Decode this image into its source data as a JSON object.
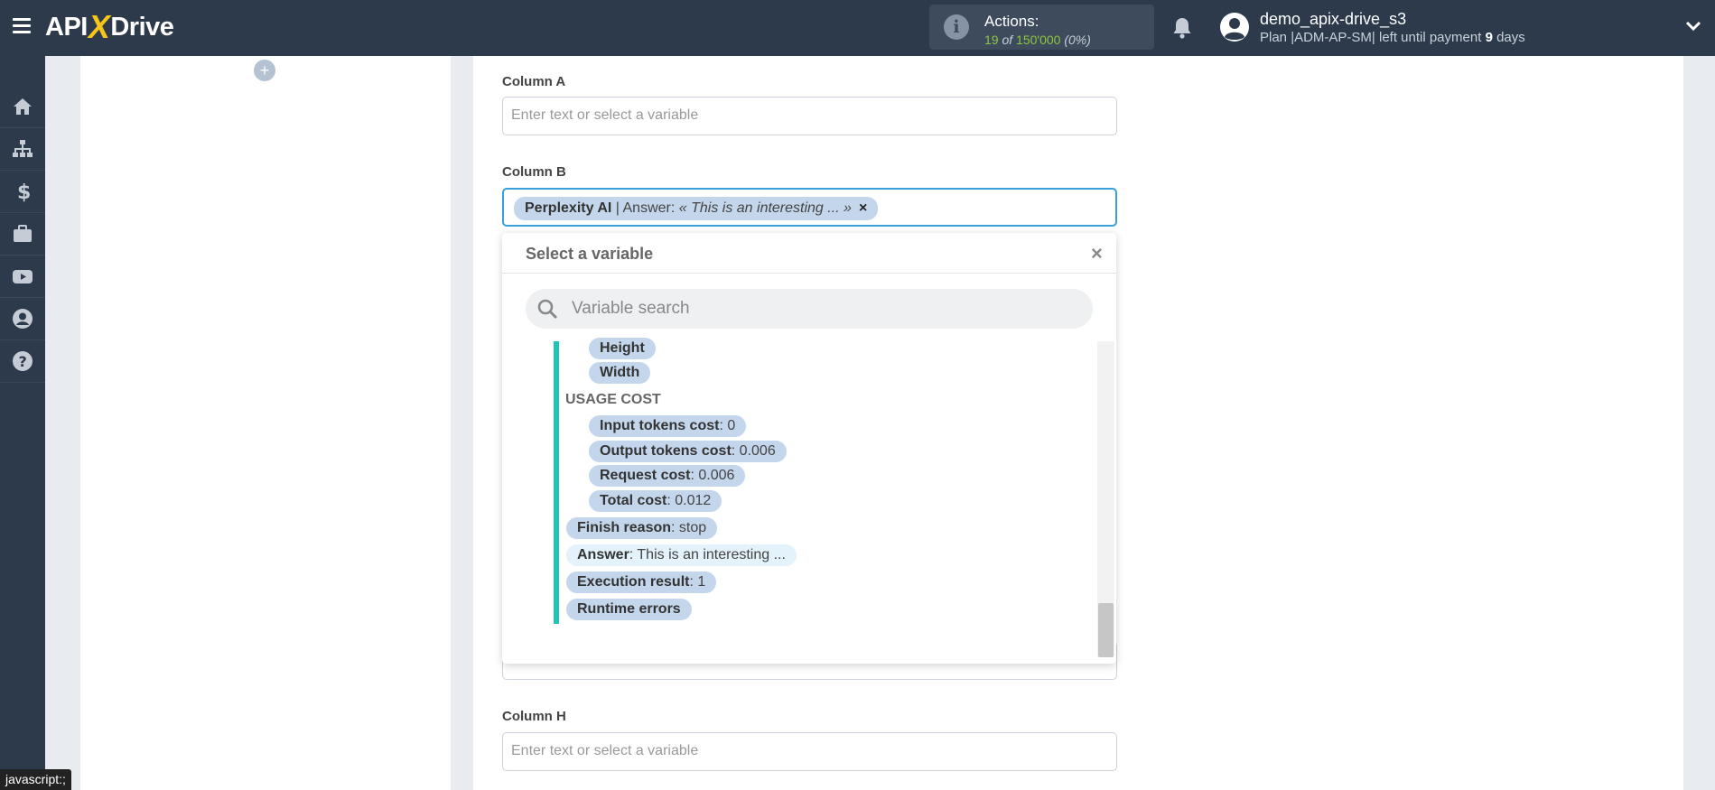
{
  "header": {
    "logo_api": "API",
    "logo_x": "X",
    "logo_drive": "Drive",
    "actions_label": "Actions:",
    "actions_used": "19",
    "actions_of": "of",
    "actions_total": "150'000",
    "actions_percent": "(0%)",
    "user_name": "demo_apix-drive_s3",
    "plan_prefix": "Plan |ADM-AP-SM| left until payment",
    "plan_days": "9",
    "plan_suffix": "days"
  },
  "sidebar": {
    "items": [
      "home-icon",
      "sitemap-icon",
      "dollar-icon",
      "briefcase-icon",
      "youtube-icon",
      "user-icon",
      "help-icon"
    ]
  },
  "form": {
    "column_a_label": "Column A",
    "column_a_placeholder": "Enter text or select a variable",
    "column_b_label": "Column B",
    "column_b_tag": {
      "source": "Perplexity AI",
      "sep": " | Answer: ",
      "value": "« This is an interesting ... »",
      "remove": "×"
    },
    "column_h_label": "Column H",
    "column_h_placeholder": "Enter text or select a variable"
  },
  "variable_picker": {
    "title": "Select a variable",
    "close": "×",
    "search_placeholder": "Variable search",
    "items": [
      {
        "name": "Height",
        "value": ""
      },
      {
        "name": "Width",
        "value": ""
      },
      {
        "name": "Input tokens cost",
        "value": ": 0"
      },
      {
        "name": "Output tokens cost",
        "value": ": 0.006"
      },
      {
        "name": "Request cost",
        "value": ": 0.006"
      },
      {
        "name": "Total cost",
        "value": ": 0.012"
      },
      {
        "name": "Finish reason",
        "value": ": stop"
      },
      {
        "name": "Answer",
        "value": ": This is an interesting ..."
      },
      {
        "name": "Execution result",
        "value": ": 1"
      },
      {
        "name": "Runtime errors",
        "value": ""
      }
    ],
    "group_usage_cost": "USAGE COST"
  },
  "status_tip": "javascript:;",
  "colors": {
    "topbar": "#2d3a4b",
    "accent_teal": "#1ec5b8",
    "tag_bg": "#c4d6ec",
    "active_border": "#3ba0d8",
    "green": "#8cc63f"
  }
}
